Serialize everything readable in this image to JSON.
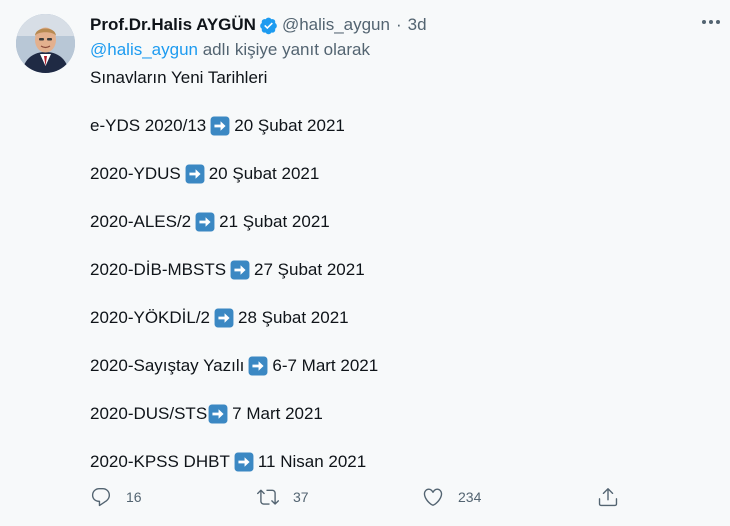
{
  "author": {
    "name": "Prof.Dr.Halis AYGÜN",
    "handle": "@halis_aygun",
    "separator": "·",
    "time": "3d",
    "verified_color": "#1d9bf0"
  },
  "reply": {
    "mention": "@halis_aygun",
    "suffix": " adlı kişiye yanıt olarak"
  },
  "tweet": {
    "heading": "Sınavların Yeni Tarihleri",
    "lines": [
      {
        "exam": "e-YDS 2020/13",
        "date": "20 Şubat 2021"
      },
      {
        "exam": "2020-YDUS",
        "date": "20 Şubat 2021"
      },
      {
        "exam": "2020-ALES/2",
        "date": "21 Şubat 2021"
      },
      {
        "exam": "2020-DİB-MBSTS",
        "date": "27 Şubat 2021"
      },
      {
        "exam": "2020-YÖKDİL/2",
        "date": "28 Şubat 2021"
      },
      {
        "exam": "2020-Sayıştay Yazılı",
        "date": "6-7 Mart 2021"
      },
      {
        "exam": "2020-DUS/STS",
        "date": "7 Mart 2021"
      },
      {
        "exam": "2020-KPSS DHBT",
        "date": "11 Nisan 2021"
      }
    ],
    "arrow_icon": "right-arrow-emoji",
    "arrow_color": "#3b88c3"
  },
  "actions": {
    "replies": "16",
    "retweets": "37",
    "likes": "234",
    "icons": [
      "reply-icon",
      "retweet-icon",
      "like-icon",
      "share-icon"
    ]
  }
}
